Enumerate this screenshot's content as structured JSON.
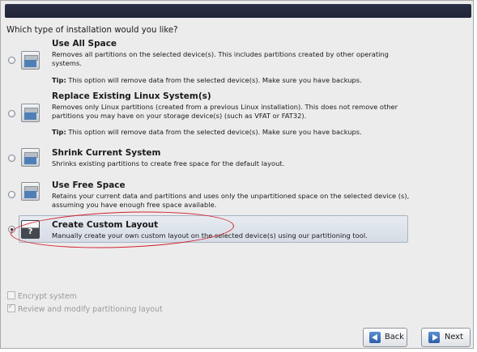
{
  "header": {
    "question": "Which type of installation would you like?"
  },
  "options": [
    {
      "title": "Use All Space",
      "description": "Removes all partitions on the selected device(s).  This includes partitions created by other operating systems.",
      "tip_label": "Tip:",
      "tip_text": " This option will remove data from the selected device(s).  Make sure you have backups.",
      "selected": false
    },
    {
      "title": "Replace Existing Linux System(s)",
      "description": "Removes only Linux partitions (created from a previous Linux installation).  This does not remove other partitions you may have on your storage device(s) (such as VFAT or FAT32).",
      "tip_label": "Tip:",
      "tip_text": " This option will remove data from the selected device(s).  Make sure you have backups.",
      "selected": false
    },
    {
      "title": "Shrink Current System",
      "description": "Shrinks existing partitions to create free space for the default layout.",
      "selected": false
    },
    {
      "title": "Use Free Space",
      "description": "Retains your current data and partitions and uses only the unpartitioned space on the selected device (s), assuming you have enough free space available.",
      "selected": false
    },
    {
      "title": "Create Custom Layout",
      "description": "Manually create your own custom layout on the selected device(s) using our partitioning tool.",
      "icon_glyph": "?",
      "selected": true
    }
  ],
  "checkboxes": {
    "encrypt_label": "Encrypt system",
    "encrypt_checked": false,
    "review_label": "Review and modify partitioning layout",
    "review_checked": true
  },
  "buttons": {
    "back": "Back",
    "next": "Next"
  },
  "colors": {
    "highlight_annotation": "#d21f2d",
    "selected_row": "#dde2ea",
    "header_bar": "#262b40"
  }
}
